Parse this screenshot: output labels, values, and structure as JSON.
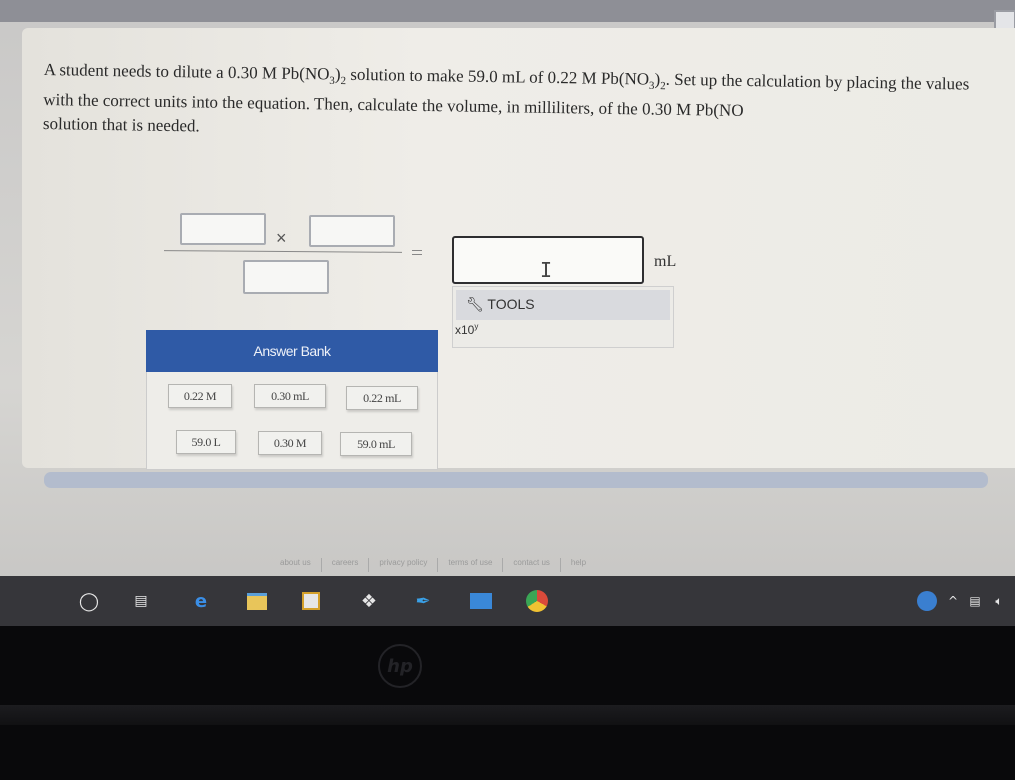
{
  "question": {
    "part1": "A student needs to dilute a 0.30 M Pb(NO",
    "sub3a": "3",
    "part2": ")",
    "sub2a": "2",
    "part3": " solution to make 59.0 mL of 0.22 M Pb(NO",
    "sub3b": "3",
    "part4": ")",
    "sub2b": "2",
    "part5": ". Set up the calculation by placing the values with the correct units into the equation. Then, calculate the volume, in milliliters, of the 0.30 M Pb(NO",
    "part6": "solution that is needed."
  },
  "equation": {
    "operator_times": "×",
    "unit": "mL"
  },
  "tools": {
    "label": "TOOLS",
    "sci_notation": "x10",
    "sci_exp": "y"
  },
  "answer_bank": {
    "title": "Answer Bank",
    "chips": [
      "0.22 M",
      "0.30 mL",
      "0.22 mL",
      "59.0 L",
      "0.30 M",
      "59.0 mL"
    ]
  },
  "footer": {
    "links": [
      "about us",
      "careers",
      "privacy policy",
      "terms of use",
      "contact us",
      "help"
    ]
  },
  "taskbar": {
    "icons": [
      "cortana-icon",
      "task-view-icon",
      "edge-icon",
      "file-explorer-icon",
      "store-icon",
      "dropbox-icon",
      "feather-icon",
      "mail-icon",
      "chrome-icon"
    ]
  },
  "brand": {
    "logo": "hp",
    "accent": "#2f5aa6"
  }
}
